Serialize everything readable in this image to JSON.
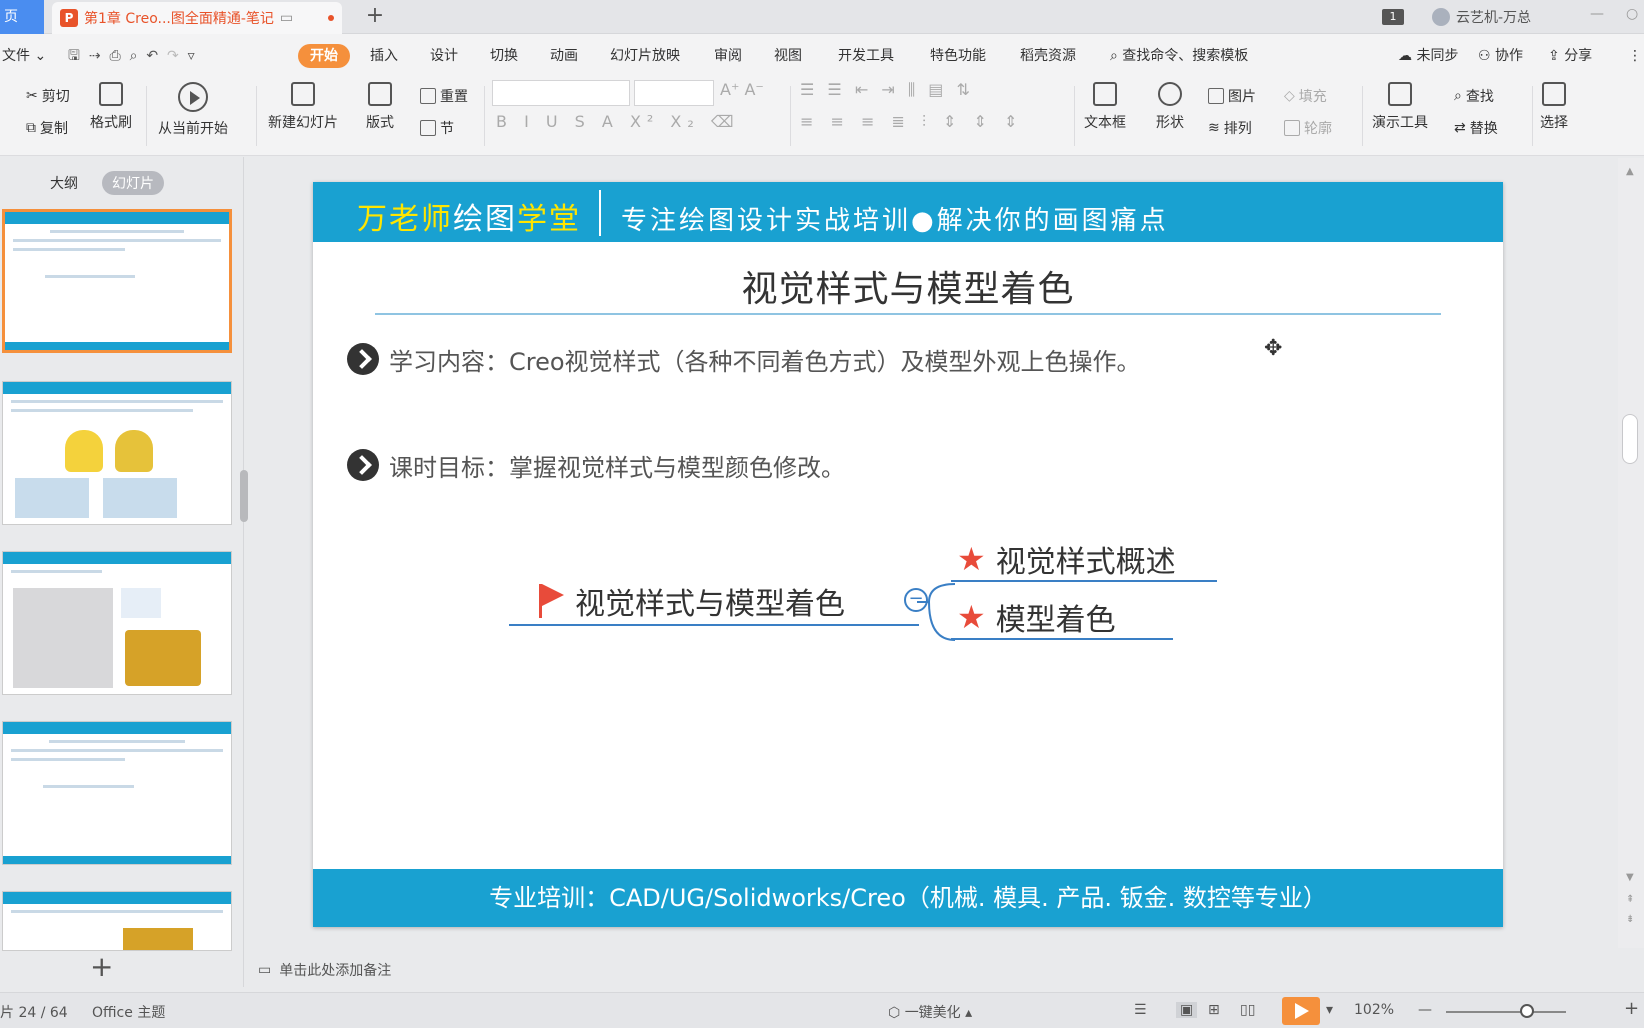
{
  "tabbar": {
    "home_label": "页",
    "doc_title": "第1章 Creo...图全面精通-笔记",
    "new_tab": "+",
    "window_count": "1",
    "user": "云艺机-万总",
    "minimize": "—",
    "restore": "○"
  },
  "menubar": {
    "file": "文件",
    "items": [
      "开始",
      "插入",
      "设计",
      "切换",
      "动画",
      "幻灯片放映",
      "审阅",
      "视图",
      "开发工具",
      "特色功能",
      "稻壳资源"
    ],
    "search": "查找命令、搜索模板",
    "sync": "未同步",
    "collab": "协作",
    "share": "分享"
  },
  "ribbon": {
    "cut": "剪切",
    "copy": "复制",
    "format_painter": "格式刷",
    "from_current": "从当前开始",
    "new_slide": "新建幻灯片",
    "layout": "版式",
    "reset": "重置",
    "section": "节",
    "textbox": "文本框",
    "shape": "形状",
    "picture": "图片",
    "arrange": "排列",
    "fill": "填充",
    "outline": "轮廓",
    "present_tools": "演示工具",
    "find": "查找",
    "replace": "替换",
    "select": "选择"
  },
  "leftpane": {
    "outline_tab": "大纲",
    "slides_tab": "幻灯片",
    "add_slide": "+"
  },
  "slide": {
    "brand_yellow_1": "万老师",
    "brand_white": "绘图",
    "brand_yellow_2": "学堂",
    "slogan": "专注绘图设计实战培训●解决你的画图痛点",
    "title": "视觉样式与模型着色",
    "bullet1": "学习内容：Creo视觉样式（各种不同着色方式）及模型外观上色操作。",
    "bullet2": "课时目标：掌握视觉样式与模型颜色修改。",
    "mindmap": {
      "root": "视觉样式与模型着色",
      "collapse": "−",
      "children": [
        "视觉样式概述",
        "模型着色"
      ]
    },
    "footer": "专业培训：CAD/UG/Solidworks/Creo（机械. 模具. 产品. 钣金. 数控等专业）"
  },
  "notes_placeholder": "单击此处添加备注",
  "statusbar": {
    "slide_counter": "片 24 / 64",
    "theme": "Office 主题",
    "beautify": "一键美化",
    "zoom": "102%",
    "zoom_out": "—",
    "zoom_in": "+"
  },
  "colors": {
    "accent_orange": "#f5903c",
    "slide_blue": "#19a1d1",
    "brand_yellow": "#ffe500",
    "mindmap_blue": "#3a7fc5",
    "star_red": "#e84b3a"
  }
}
